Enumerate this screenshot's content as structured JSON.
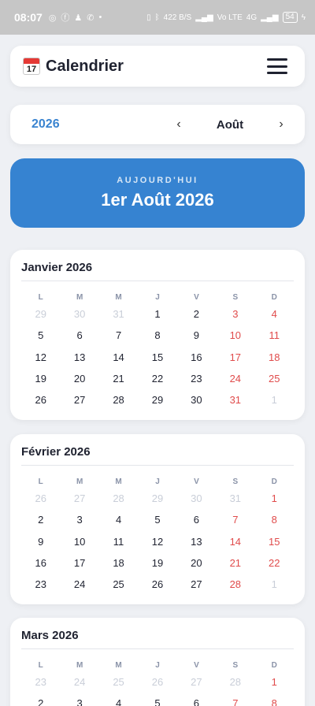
{
  "status": {
    "time": "08:07",
    "speed": "422",
    "speed_unit": "B/S",
    "network": "Vo LTE",
    "net_4g": "4G",
    "battery": "54"
  },
  "header": {
    "icon_number": "17",
    "title": "Calendrier"
  },
  "nav": {
    "year": "2026",
    "month": "Août",
    "prev": "‹",
    "next": "›"
  },
  "today": {
    "label": "AUJOURD'HUI",
    "date": "1er Août 2026"
  },
  "weekdays": [
    "L",
    "M",
    "M",
    "J",
    "V",
    "S",
    "D"
  ],
  "months": [
    {
      "title": "Janvier 2026",
      "weeks": [
        [
          {
            "d": "29",
            "o": true
          },
          {
            "d": "30",
            "o": true
          },
          {
            "d": "31",
            "o": true
          },
          {
            "d": "1"
          },
          {
            "d": "2"
          },
          {
            "d": "3",
            "w": true
          },
          {
            "d": "4",
            "w": true
          }
        ],
        [
          {
            "d": "5"
          },
          {
            "d": "6"
          },
          {
            "d": "7"
          },
          {
            "d": "8"
          },
          {
            "d": "9"
          },
          {
            "d": "10",
            "w": true
          },
          {
            "d": "11",
            "w": true
          }
        ],
        [
          {
            "d": "12"
          },
          {
            "d": "13"
          },
          {
            "d": "14"
          },
          {
            "d": "15"
          },
          {
            "d": "16"
          },
          {
            "d": "17",
            "w": true
          },
          {
            "d": "18",
            "w": true
          }
        ],
        [
          {
            "d": "19"
          },
          {
            "d": "20"
          },
          {
            "d": "21"
          },
          {
            "d": "22"
          },
          {
            "d": "23"
          },
          {
            "d": "24",
            "w": true
          },
          {
            "d": "25",
            "w": true
          }
        ],
        [
          {
            "d": "26"
          },
          {
            "d": "27"
          },
          {
            "d": "28"
          },
          {
            "d": "29"
          },
          {
            "d": "30"
          },
          {
            "d": "31",
            "w": true
          },
          {
            "d": "1",
            "o": true
          }
        ]
      ]
    },
    {
      "title": "Février 2026",
      "weeks": [
        [
          {
            "d": "26",
            "o": true
          },
          {
            "d": "27",
            "o": true
          },
          {
            "d": "28",
            "o": true
          },
          {
            "d": "29",
            "o": true
          },
          {
            "d": "30",
            "o": true
          },
          {
            "d": "31",
            "o": true
          },
          {
            "d": "1",
            "w": true
          }
        ],
        [
          {
            "d": "2"
          },
          {
            "d": "3"
          },
          {
            "d": "4"
          },
          {
            "d": "5"
          },
          {
            "d": "6"
          },
          {
            "d": "7",
            "w": true
          },
          {
            "d": "8",
            "w": true
          }
        ],
        [
          {
            "d": "9"
          },
          {
            "d": "10"
          },
          {
            "d": "11"
          },
          {
            "d": "12"
          },
          {
            "d": "13"
          },
          {
            "d": "14",
            "w": true
          },
          {
            "d": "15",
            "w": true
          }
        ],
        [
          {
            "d": "16"
          },
          {
            "d": "17"
          },
          {
            "d": "18"
          },
          {
            "d": "19"
          },
          {
            "d": "20"
          },
          {
            "d": "21",
            "w": true
          },
          {
            "d": "22",
            "w": true
          }
        ],
        [
          {
            "d": "23"
          },
          {
            "d": "24"
          },
          {
            "d": "25"
          },
          {
            "d": "26"
          },
          {
            "d": "27"
          },
          {
            "d": "28",
            "w": true
          },
          {
            "d": "1",
            "o": true
          }
        ]
      ]
    },
    {
      "title": "Mars 2026",
      "weeks": [
        [
          {
            "d": "23",
            "o": true
          },
          {
            "d": "24",
            "o": true
          },
          {
            "d": "25",
            "o": true
          },
          {
            "d": "26",
            "o": true
          },
          {
            "d": "27",
            "o": true
          },
          {
            "d": "28",
            "o": true
          },
          {
            "d": "1",
            "w": true
          }
        ],
        [
          {
            "d": "2"
          },
          {
            "d": "3"
          },
          {
            "d": "4"
          },
          {
            "d": "5"
          },
          {
            "d": "6"
          },
          {
            "d": "7",
            "w": true
          },
          {
            "d": "8",
            "w": true
          }
        ]
      ]
    }
  ]
}
